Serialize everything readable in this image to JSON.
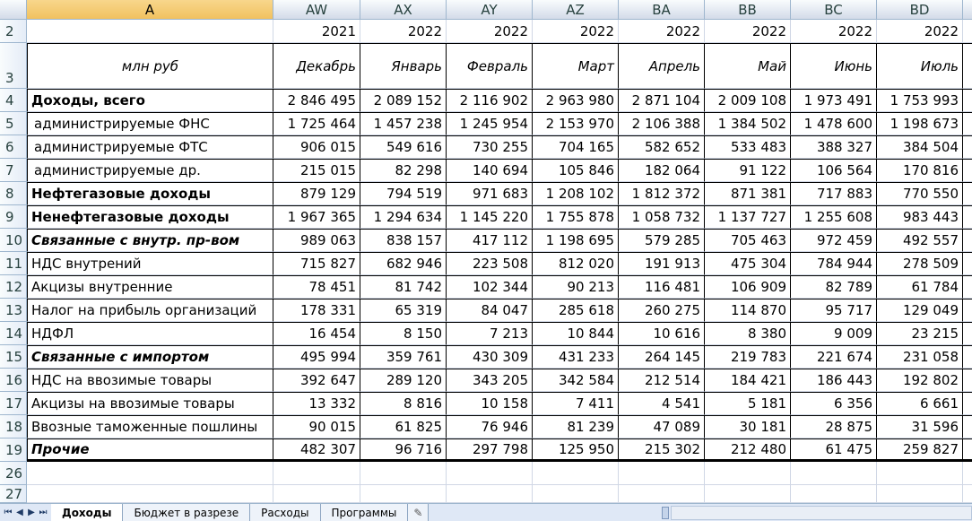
{
  "columns": [
    "A",
    "AW",
    "AX",
    "AY",
    "AZ",
    "BA",
    "BB",
    "BC",
    "BD"
  ],
  "rows": {
    "r2": {
      "num": "2",
      "years": [
        "2021",
        "2022",
        "2022",
        "2022",
        "2022",
        "2022",
        "2022",
        "2022"
      ]
    },
    "r3": {
      "num": "3",
      "unit": "млн руб",
      "months": [
        "Декабрь",
        "Январь",
        "Февраль",
        "Март",
        "Апрель",
        "Май",
        "Июнь",
        "Июль"
      ]
    },
    "body": [
      {
        "num": "4",
        "label": "Доходы, всего",
        "style": "bold",
        "values": [
          "2 846 495",
          "2 089 152",
          "2 116 902",
          "2 963 980",
          "2 871 104",
          "2 009 108",
          "1 973 491",
          "1 753 993"
        ]
      },
      {
        "num": "5",
        "label": "администрируемые ФНС",
        "style": "indent",
        "values": [
          "1 725 464",
          "1 457 238",
          "1 245 954",
          "2 153 970",
          "2 106 388",
          "1 384 502",
          "1 478 600",
          "1 198 673"
        ]
      },
      {
        "num": "6",
        "label": "администрируемые ФТС",
        "style": "indent",
        "values": [
          "906 015",
          "549 616",
          "730 255",
          "704 165",
          "582 652",
          "533 483",
          "388 327",
          "384 504"
        ]
      },
      {
        "num": "7",
        "label": "администрируемые др.",
        "style": "indent",
        "values": [
          "215 015",
          "82 298",
          "140 694",
          "105 846",
          "182 064",
          "91 122",
          "106 564",
          "170 816"
        ]
      },
      {
        "num": "8",
        "label": "Нефтегазовые доходы",
        "style": "bold",
        "values": [
          "879 129",
          "794 519",
          "971 683",
          "1 208 102",
          "1 812 372",
          "871 381",
          "717 883",
          "770 550"
        ]
      },
      {
        "num": "9",
        "label": "Ненефтегазовые доходы",
        "style": "bold",
        "values": [
          "1 967 365",
          "1 294 634",
          "1 145 220",
          "1 755 878",
          "1 058 732",
          "1 137 727",
          "1 255 608",
          "983 443"
        ]
      },
      {
        "num": "10",
        "label": "Связанные с внутр. пр-вом",
        "style": "bi",
        "values": [
          "989 063",
          "838 157",
          "417 112",
          "1 198 695",
          "579 285",
          "705 463",
          "972 459",
          "492 557"
        ]
      },
      {
        "num": "11",
        "label": "НДС внутрений",
        "style": "plain",
        "values": [
          "715 827",
          "682 946",
          "223 508",
          "812 020",
          "191 913",
          "475 304",
          "784 944",
          "278 509"
        ]
      },
      {
        "num": "12",
        "label": "Акцизы внутренние",
        "style": "plain",
        "values": [
          "78 451",
          "81 742",
          "102 344",
          "90 213",
          "116 481",
          "106 909",
          "82 789",
          "61 784"
        ]
      },
      {
        "num": "13",
        "label": "Налог на прибыль организаций",
        "style": "plain",
        "values": [
          "178 331",
          "65 319",
          "84 047",
          "285 618",
          "260 275",
          "114 870",
          "95 717",
          "129 049"
        ]
      },
      {
        "num": "14",
        "label": "НДФЛ",
        "style": "plain",
        "values": [
          "16 454",
          "8 150",
          "7 213",
          "10 844",
          "10 616",
          "8 380",
          "9 009",
          "23 215"
        ]
      },
      {
        "num": "15",
        "label": "Связанные с импортом",
        "style": "bi",
        "values": [
          "495 994",
          "359 761",
          "430 309",
          "431 233",
          "264 145",
          "219 783",
          "221 674",
          "231 058"
        ]
      },
      {
        "num": "16",
        "label": "НДС на ввозимые товары",
        "style": "plain",
        "values": [
          "392 647",
          "289 120",
          "343 205",
          "342 584",
          "212 514",
          "184 421",
          "186 443",
          "192 802"
        ]
      },
      {
        "num": "17",
        "label": "Акцизы на ввозимые товары",
        "style": "plain",
        "values": [
          "13 332",
          "8 816",
          "10 158",
          "7 411",
          "4 541",
          "5 181",
          "6 356",
          "6 661"
        ]
      },
      {
        "num": "18",
        "label": "Ввозные таможенные пошлины",
        "style": "plain",
        "values": [
          "90 015",
          "61 825",
          "76 946",
          "81 239",
          "47 089",
          "30 181",
          "28 875",
          "31 596"
        ]
      },
      {
        "num": "19",
        "label": "Прочие",
        "style": "bi",
        "values": [
          "482 307",
          "96 716",
          "297 798",
          "125 950",
          "215 302",
          "212 480",
          "61 475",
          "259 827"
        ]
      }
    ],
    "after": [
      {
        "num": "26"
      },
      {
        "num": "27"
      }
    ]
  },
  "sheet_tabs": [
    {
      "label": "Доходы",
      "active": true
    },
    {
      "label": "Бюджет в разрезе",
      "active": false
    },
    {
      "label": "Расходы",
      "active": false
    },
    {
      "label": "Программы",
      "active": false
    }
  ],
  "nav_icons": [
    "first-sheet-icon",
    "prev-sheet-icon",
    "next-sheet-icon",
    "last-sheet-icon"
  ],
  "new_sheet_icon": "insert-sheet-icon"
}
